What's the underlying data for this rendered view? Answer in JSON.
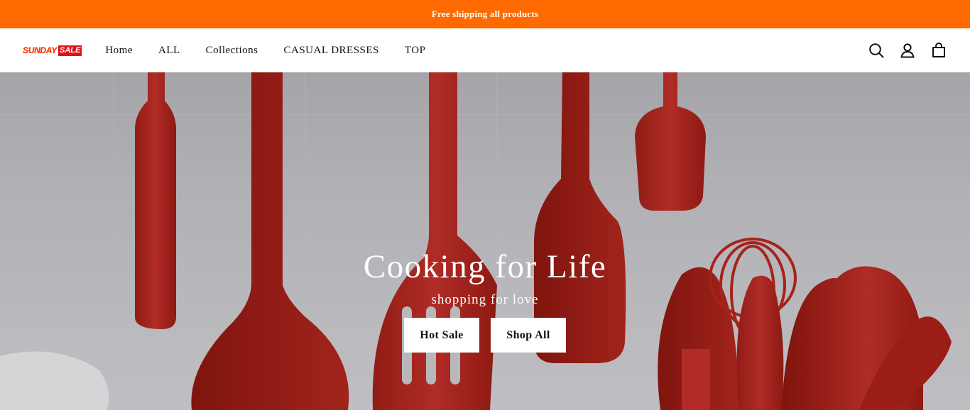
{
  "announcement": {
    "text": "Free shipping all products"
  },
  "header": {
    "logo": {
      "word1": "SUNDAY",
      "word2": "SALE"
    },
    "nav": [
      {
        "label": "Home"
      },
      {
        "label": "ALL"
      },
      {
        "label": "Collections"
      },
      {
        "label": "CASUAL DRESSES"
      },
      {
        "label": "TOP"
      }
    ],
    "icons": [
      "search-icon",
      "account-icon",
      "cart-icon"
    ]
  },
  "hero": {
    "title": "Cooking for Life",
    "subtitle": "shopping for love",
    "buttons": [
      {
        "label": "Hot Sale"
      },
      {
        "label": "Shop All"
      }
    ]
  },
  "colors": {
    "announcement_bg": "#ff6a00",
    "utensil_red": "#b3261e",
    "hero_bg": "#b9b8bd"
  }
}
